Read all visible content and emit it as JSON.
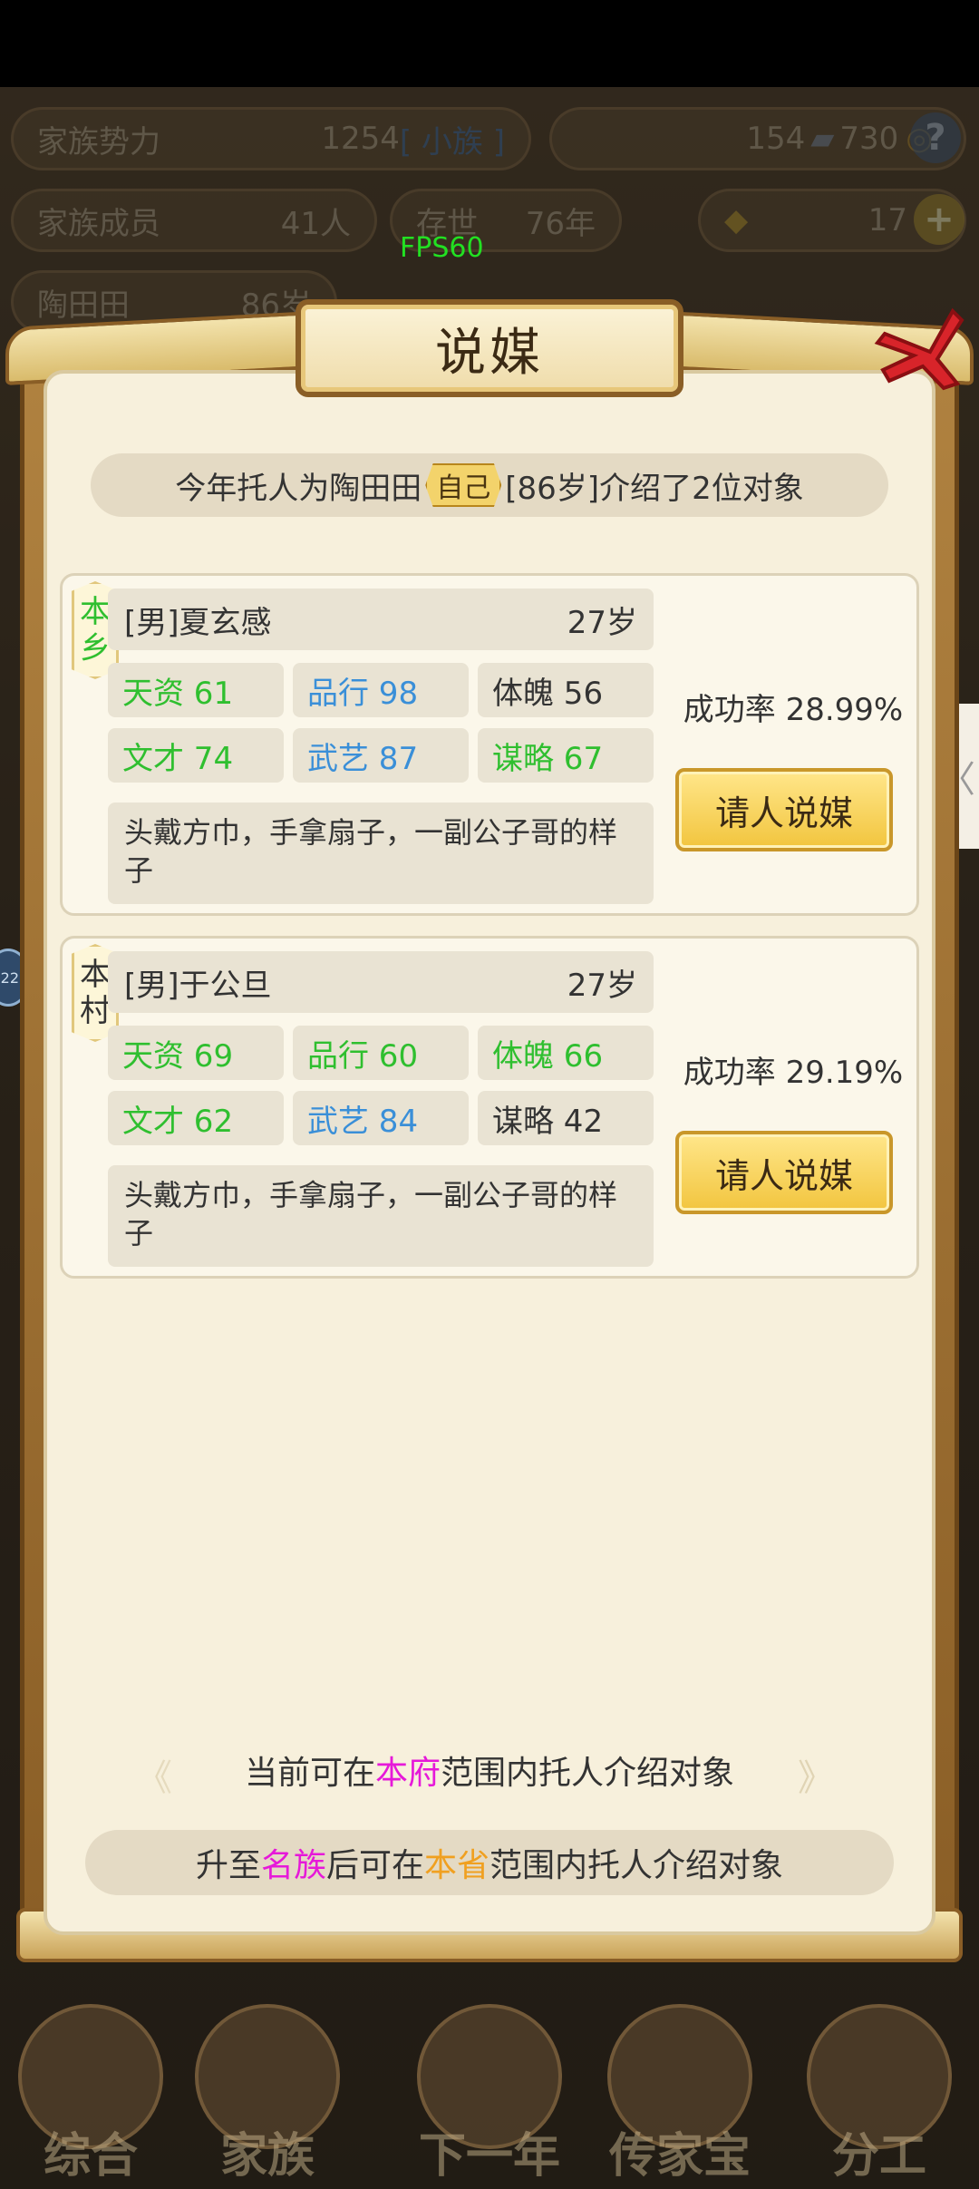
{
  "hud": {
    "family_power_label": "家族势力",
    "family_power_value": "1254",
    "family_power_tag": "[ 小族 ]",
    "currency_silver": "154",
    "currency_copper": "730",
    "help_icon_label": "?",
    "members_label": "家族成员",
    "members_value": "41人",
    "alive_label": "存世",
    "alive_value": "76年",
    "gold_value": "17",
    "plus_label": "+",
    "leader_name": "陶田田",
    "leader_age": "86岁",
    "fps": "FPS60"
  },
  "dialog": {
    "title": "说媒",
    "intro_prefix": "今年托人为陶田田",
    "intro_tag": "自己",
    "intro_suffix": "[86岁]介绍了2位对象",
    "candidates": [
      {
        "origin_line1": "本",
        "origin_line2": "乡",
        "name": "[男]夏玄感",
        "age": "27岁",
        "stats": [
          {
            "label": "天资 61",
            "color": "#2fbf2f"
          },
          {
            "label": "品行 98",
            "color": "#3a8fd8"
          },
          {
            "label": "体魄 56",
            "color": "#333333"
          },
          {
            "label": "文才 74",
            "color": "#2fbf2f"
          },
          {
            "label": "武艺 87",
            "color": "#3a8fd8"
          },
          {
            "label": "谋略 67",
            "color": "#2fbf2f"
          }
        ],
        "description": "头戴方巾，手拿扇子，一副公子哥的样子",
        "success_rate": "成功率 28.99%",
        "button_label": "请人说媒"
      },
      {
        "origin_line1": "本",
        "origin_line2": "村",
        "name": "[男]于公旦",
        "age": "27岁",
        "stats": [
          {
            "label": "天资 69",
            "color": "#2fbf2f"
          },
          {
            "label": "品行 60",
            "color": "#2fbf2f"
          },
          {
            "label": "体魄 66",
            "color": "#2fbf2f"
          },
          {
            "label": "文才 62",
            "color": "#2fbf2f"
          },
          {
            "label": "武艺 84",
            "color": "#3a8fd8"
          },
          {
            "label": "谋略 42",
            "color": "#333333"
          }
        ],
        "description": "头戴方巾，手拿扇子，一副公子哥的样子",
        "success_rate": "成功率 29.19%",
        "button_label": "请人说媒"
      }
    ],
    "scope_prefix": "当前可在",
    "scope_highlight": "本府",
    "scope_suffix": "范围内托人介绍对象",
    "upgrade_prefix": "升至",
    "upgrade_rank": "名族",
    "upgrade_mid": "后可在",
    "upgrade_region": "本省",
    "upgrade_suffix": "范围内托人介绍对象",
    "colors": {
      "magenta": "#e619d9",
      "orange": "#f0a020"
    }
  },
  "side": {
    "tab_arrow": "〈",
    "badge_text": "22"
  },
  "nav": [
    {
      "label": "综合",
      "icon": "scroll-icon"
    },
    {
      "label": "家族",
      "icon": "house-icon"
    },
    {
      "label": "下一年",
      "icon": "mountain-icon"
    },
    {
      "label": "传家宝",
      "icon": "treasure-icon"
    },
    {
      "label": "分工",
      "icon": "people-icon"
    }
  ]
}
